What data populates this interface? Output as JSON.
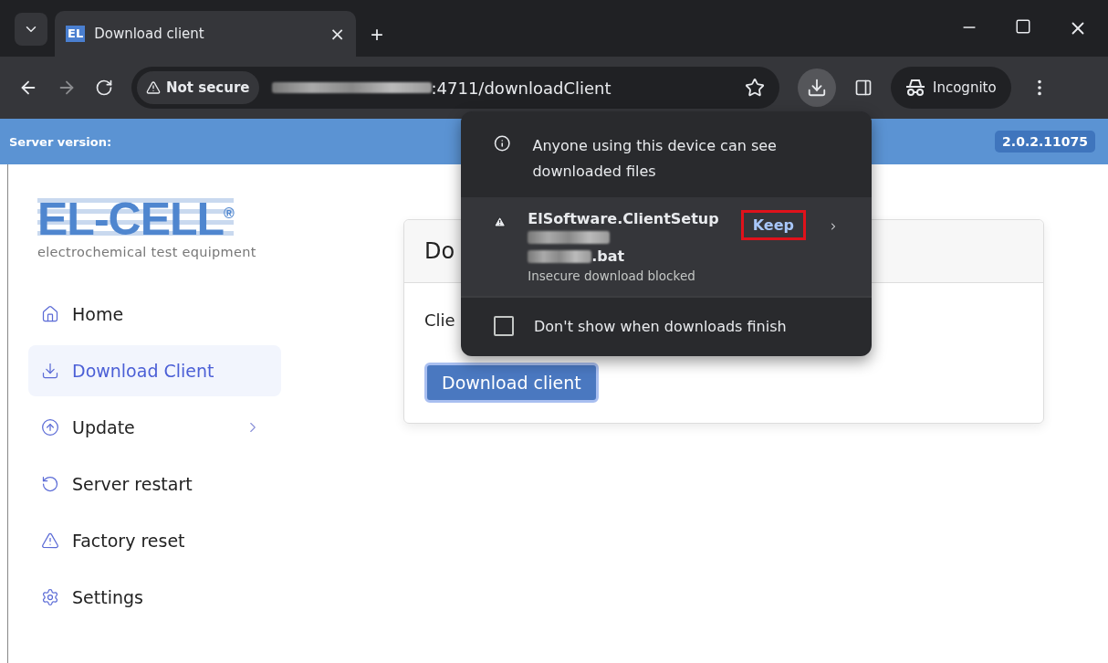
{
  "browser": {
    "tab": {
      "favicon": "EL",
      "title": "Download client",
      "close": "×"
    },
    "new_tab": "+",
    "address": {
      "security": "Not secure",
      "url_visible": ":4711/downloadClient"
    },
    "profile": "Incognito"
  },
  "header": {
    "label": "Server version:",
    "version": "2.0.2.11075"
  },
  "logo": {
    "name": "EL-CELL",
    "mark": "®",
    "tagline": "electrochemical test equipment"
  },
  "nav": [
    {
      "label": "Home",
      "kind": "home",
      "selected": false,
      "has_children": false
    },
    {
      "label": "Download Client",
      "kind": "download",
      "selected": true,
      "has_children": false
    },
    {
      "label": "Update",
      "kind": "update",
      "selected": false,
      "has_children": true
    },
    {
      "label": "Server restart",
      "kind": "restart",
      "selected": false,
      "has_children": false
    },
    {
      "label": "Factory reset",
      "kind": "warning",
      "selected": false,
      "has_children": false
    },
    {
      "label": "Settings",
      "kind": "settings",
      "selected": false,
      "has_children": false
    }
  ],
  "card": {
    "title": "Do",
    "text": "Clie",
    "button": "Download client"
  },
  "downloads_popup": {
    "notice": "Anyone using this device can see downloaded files",
    "item": {
      "name": "ElSoftware.ClientSetup",
      "name_end": ".bat",
      "status": "Insecure download blocked",
      "action": "Keep",
      "action_highlighted": true
    },
    "checkbox": {
      "label": "Don't show when downloads finish",
      "checked": false
    }
  }
}
